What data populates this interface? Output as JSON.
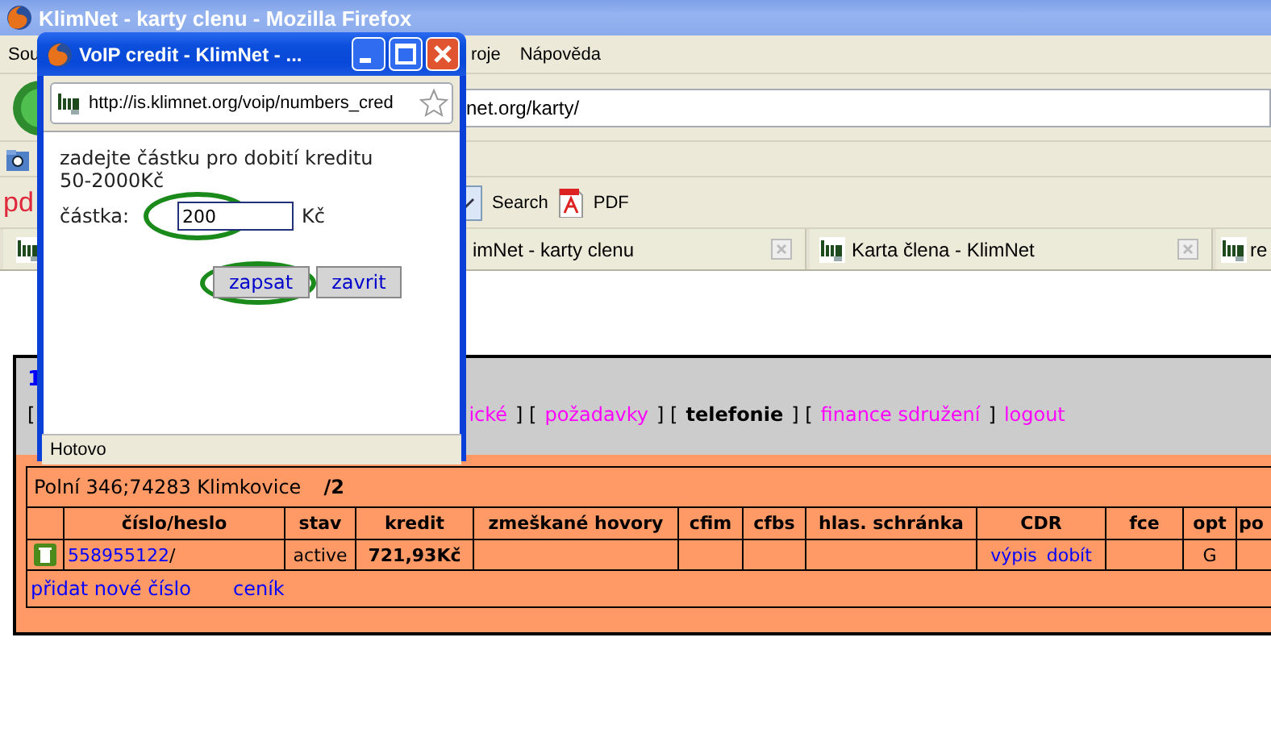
{
  "browser": {
    "title": "KlimNet - karty clenu - Mozilla Firefox",
    "menu": [
      "Sou",
      "roje",
      "Nápověda"
    ],
    "address": "net.org/karty/",
    "toolbar": {
      "logo_partial": "pd",
      "search_label": "Search",
      "pdf_label": "PDF"
    },
    "tabs": [
      {
        "label": "imNet - karty clenu"
      },
      {
        "label": "Karta člena - KlimNet"
      },
      {
        "label": "re"
      }
    ]
  },
  "page": {
    "heading_partial": "1",
    "nav": [
      {
        "text": "[",
        "kind": "plain"
      },
      {
        "text": "ické",
        "kind": "link"
      },
      {
        "text": "] [",
        "kind": "plain"
      },
      {
        "text": "požadavky",
        "kind": "link"
      },
      {
        "text": "] [",
        "kind": "plain"
      },
      {
        "text": "telefonie",
        "kind": "current"
      },
      {
        "text": "] [",
        "kind": "plain"
      },
      {
        "text": "finance sdružení",
        "kind": "link"
      },
      {
        "text": "]",
        "kind": "plain"
      },
      {
        "text": "logout",
        "kind": "link"
      }
    ],
    "address_line": "Polní 346;74283 Klimkovice",
    "unit_number": "/2",
    "table": {
      "columns": [
        "",
        "číslo/heslo",
        "stav",
        "kredit",
        "zmeškané hovory",
        "cfim",
        "cfbs",
        "hlas. schránka",
        "CDR",
        "fce",
        "opt",
        "po"
      ],
      "rows": [
        {
          "number": "558955122",
          "password": "/",
          "stav": "active",
          "kredit": "721,93Kč",
          "cdr_links": [
            "výpis",
            "dobít"
          ],
          "opt": "G"
        }
      ]
    },
    "footer_links": [
      "přidat nové číslo",
      "ceník"
    ]
  },
  "popup": {
    "title": "VoIP credit - KlimNet - ...",
    "url": "http://is.klimnet.org/voip/numbers_cred",
    "prompt_lines": [
      "zadejte částku pro dobití kreditu",
      "50-2000Kč"
    ],
    "amount_field": {
      "label": "částka:",
      "value": "200",
      "unit": "Kč",
      "circled": true
    },
    "buttons": [
      {
        "label": "zapsat",
        "circled": true
      },
      {
        "label": "zavrit",
        "circled": false
      }
    ],
    "status": "Hotovo"
  }
}
